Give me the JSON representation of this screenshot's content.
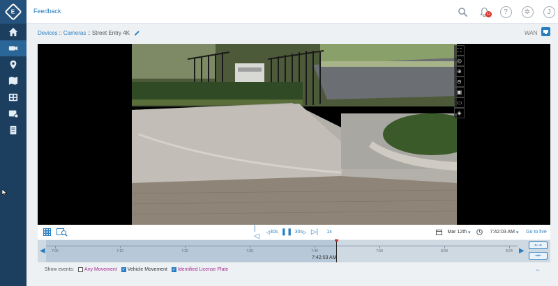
{
  "app": {
    "name": "E"
  },
  "topbar": {
    "feedback": "Feedback",
    "notifications_count": "51",
    "help": "?",
    "user": "J"
  },
  "sidebar": {
    "items": [
      {
        "icon": "home-icon"
      },
      {
        "icon": "devices-icon",
        "active": true
      },
      {
        "icon": "location-icon"
      },
      {
        "icon": "map-icon"
      },
      {
        "icon": "video-wall-icon"
      },
      {
        "icon": "recording-settings-icon"
      },
      {
        "icon": "reports-icon"
      }
    ]
  },
  "breadcrumb": {
    "devices": "Devices",
    "sep": " :: ",
    "cameras": "Cameras",
    "current": "Street Entry 4K"
  },
  "network": {
    "label": "WAN"
  },
  "video_tools": [
    "fullscreen-icon",
    "snapshot-icon",
    "zoom-in-icon",
    "zoom-out-icon",
    "image-adjust-icon",
    "overlay-icon",
    "layers-icon"
  ],
  "controls": {
    "rewind_label": "30s",
    "forward_label": "30s",
    "speed": "1x",
    "date": "Mar 12th",
    "time": "7:42:03 AM",
    "go_live": "Go to live"
  },
  "timeline": {
    "ticks": [
      "7:05",
      "7:10",
      "7:20",
      "7:30",
      "7:40",
      "7:50",
      "8:00",
      "8:04"
    ],
    "playhead_time": "7:42:03 AM",
    "playhead_fraction": 0.63
  },
  "events": {
    "label": "Show events:",
    "items": [
      {
        "label": "Any Movement",
        "checked": false,
        "color": "#a32a8f"
      },
      {
        "label": "Vehicle Movement",
        "checked": true,
        "color": "#333333"
      },
      {
        "label": "Identified License Plate",
        "checked": true,
        "color": "#a32a8f"
      }
    ]
  },
  "colors": {
    "accent": "#2a7ec0",
    "sidebar": "#1c3e5f",
    "alert": "#d8342a"
  }
}
